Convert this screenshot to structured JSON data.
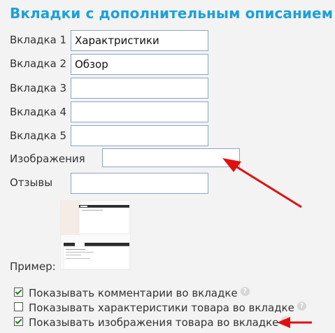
{
  "page": {
    "title": "Вкладки с дополнительным описанием"
  },
  "fields": [
    {
      "label": "Вкладка 1",
      "value": "Характристики"
    },
    {
      "label": "Вкладка 2",
      "value": "Обзор"
    },
    {
      "label": "Вкладка 3",
      "value": ""
    },
    {
      "label": "Вкладка 4",
      "value": ""
    },
    {
      "label": "Вкладка 5",
      "value": ""
    },
    {
      "label": "Изображения",
      "value": ""
    },
    {
      "label": "Отзывы",
      "value": ""
    }
  ],
  "example": {
    "label": "Пример:"
  },
  "options": [
    {
      "label": "Показывать комментарии во вкладке",
      "checked": true
    },
    {
      "label": "Показывать характеристики товара во вкладке",
      "checked": false
    },
    {
      "label": "Показывать изображения товара во вкладке",
      "checked": true
    }
  ],
  "help_icon_glyph": "?",
  "colors": {
    "title": "#1ea0d8",
    "arrow": "#e01010"
  }
}
